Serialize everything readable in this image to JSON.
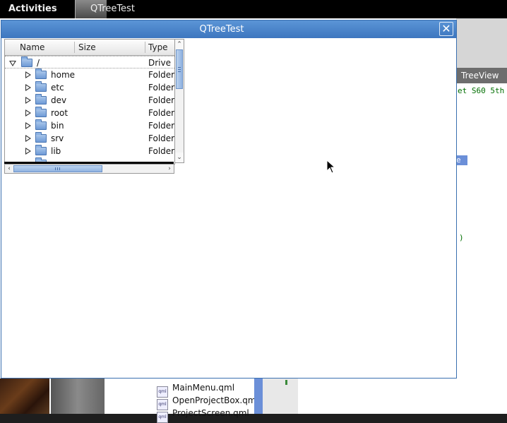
{
  "topbar": {
    "activities_label": "Activities",
    "app_name": "QTreeTest"
  },
  "background_window": {
    "treeview_tab": "TreeView",
    "code_line": "et S60 5th",
    "selected_text": "e",
    "paren_text": ")",
    "files": [
      "MainMenu.qml",
      "OpenProjectBox.qml",
      "ProjectScreen.qml"
    ]
  },
  "dialog": {
    "title": "QTreeTest",
    "close_glyph": "✕"
  },
  "tree": {
    "columns": [
      "Name",
      "Size",
      "Type"
    ],
    "root": {
      "name": "/",
      "type": "Drive"
    },
    "items": [
      {
        "name": "home",
        "type": "Folder"
      },
      {
        "name": "etc",
        "type": "Folder"
      },
      {
        "name": "dev",
        "type": "Folder"
      },
      {
        "name": "root",
        "type": "Folder"
      },
      {
        "name": "bin",
        "type": "Folder"
      },
      {
        "name": "srv",
        "type": "Folder"
      },
      {
        "name": "lib",
        "type": "Folder"
      }
    ]
  },
  "icons": {
    "expanded": "triangle-down-icon",
    "collapsed": "triangle-right-icon",
    "folder": "folder-icon",
    "drive": "folder-icon",
    "file": "qml-file-icon"
  },
  "colors": {
    "titlebar": "#3d76bf",
    "scroll_thumb": "#8fb2e0",
    "background_selection": "#6b8fd8"
  }
}
